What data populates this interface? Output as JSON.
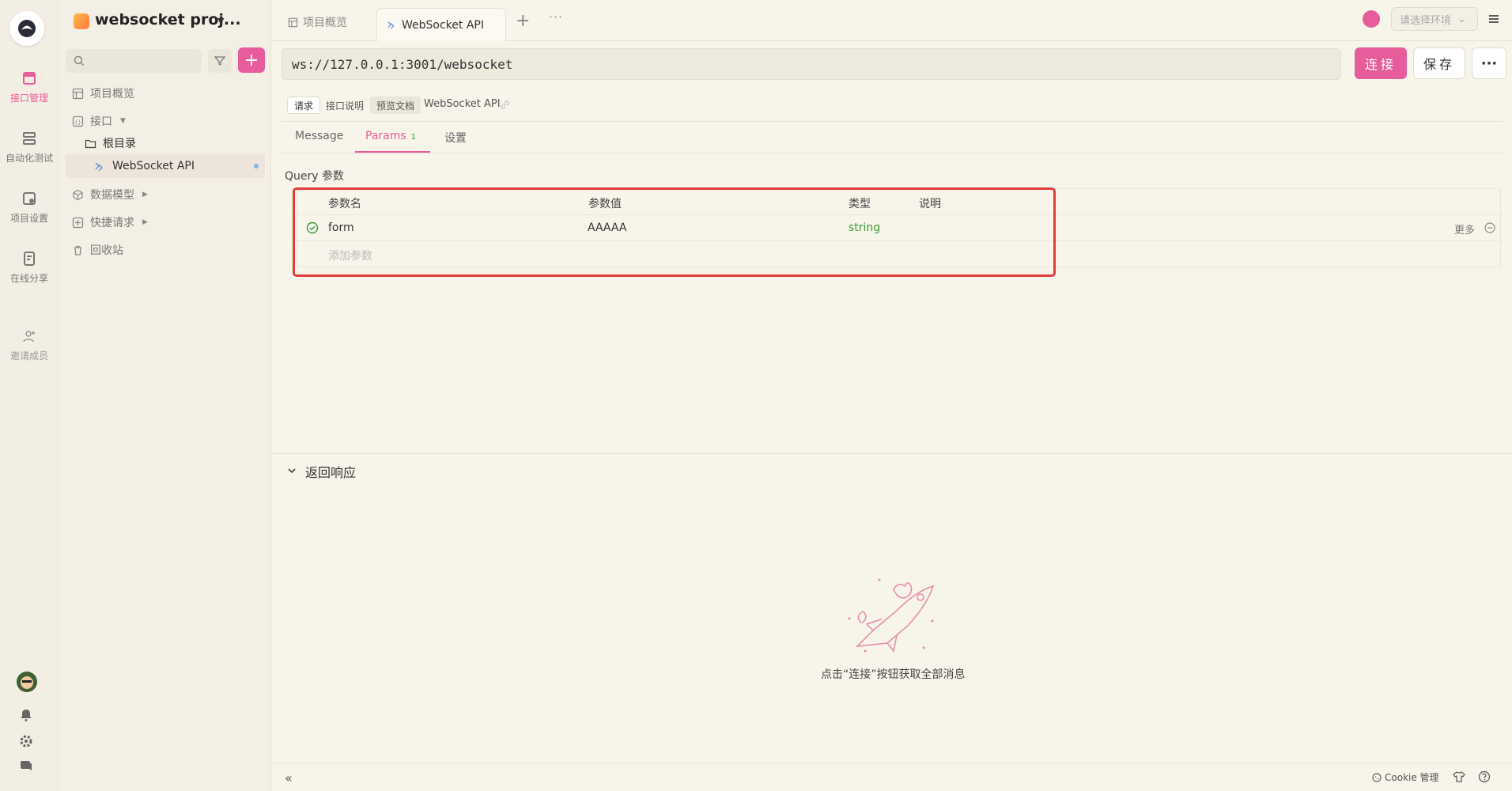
{
  "colors": {
    "accent": "#e75c9b",
    "success": "#3a9a3a",
    "highlight": "#e03c3c",
    "background": "#f7f4ea"
  },
  "rail": {
    "items": [
      {
        "label": "接口管理",
        "icon": "api-icon",
        "active": true
      },
      {
        "label": "自动化测试",
        "icon": "automation-icon"
      },
      {
        "label": "项目设置",
        "icon": "settings-box-icon"
      },
      {
        "label": "在线分享",
        "icon": "share-doc-icon"
      },
      {
        "label": "邀请成员",
        "icon": "add-user-icon"
      }
    ]
  },
  "sidebar": {
    "project_name": "websocket proj...",
    "items": {
      "overview": "项目概览",
      "interfaces": "接口",
      "root": "根目录",
      "ws_api": "WebSocket API",
      "models": "数据模型",
      "quick": "快捷请求",
      "trash": "回收站"
    }
  },
  "tabs": [
    {
      "label": "项目概览",
      "icon": "overview-icon"
    },
    {
      "label": "WebSocket API",
      "icon": "websocket-icon",
      "active": true
    }
  ],
  "env_placeholder": "请选择环境",
  "request": {
    "url": "ws://127.0.0.1:3001/websocket",
    "connect_label": "连接",
    "save_label": "保存",
    "segments": [
      "请求",
      "接口说明",
      "预览文档"
    ],
    "api_name": "WebSocket API"
  },
  "inner_tabs": {
    "message": "Message",
    "params": "Params",
    "params_count": "1",
    "settings": "设置"
  },
  "query": {
    "label": "Query 参数",
    "headers": [
      "参数名",
      "参数值",
      "类型",
      "说明"
    ],
    "rows": [
      {
        "name": "form",
        "value": "AAAAA",
        "type": "string",
        "desc": "",
        "enabled": true
      }
    ],
    "more_label": "更多",
    "add_placeholder": "添加参数"
  },
  "response": {
    "title": "返回响应",
    "empty_message": "点击“连接”按钮获取全部消息"
  },
  "footer": {
    "cookie_label": "Cookie 管理"
  }
}
